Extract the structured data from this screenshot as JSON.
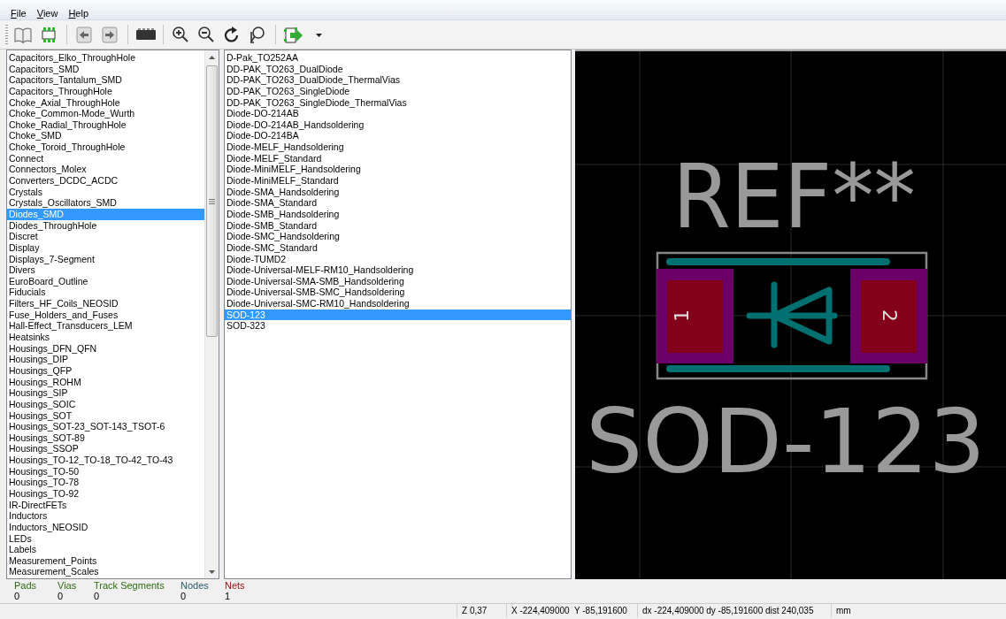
{
  "menu": [
    {
      "label": "File"
    },
    {
      "label": "View"
    },
    {
      "label": "Help"
    }
  ],
  "libraries": [
    {
      "name": "Capacitors_Elko_ThroughHole",
      "selected": false
    },
    {
      "name": "Capacitors_SMD",
      "selected": false
    },
    {
      "name": "Capacitors_Tantalum_SMD",
      "selected": false
    },
    {
      "name": "Capacitors_ThroughHole",
      "selected": false
    },
    {
      "name": "Choke_Axial_ThroughHole",
      "selected": false
    },
    {
      "name": "Choke_Common-Mode_Wurth",
      "selected": false
    },
    {
      "name": "Choke_Radial_ThroughHole",
      "selected": false
    },
    {
      "name": "Choke_SMD",
      "selected": false
    },
    {
      "name": "Choke_Toroid_ThroughHole",
      "selected": false
    },
    {
      "name": "Connect",
      "selected": false
    },
    {
      "name": "Connectors_Molex",
      "selected": false
    },
    {
      "name": "Converters_DCDC_ACDC",
      "selected": false
    },
    {
      "name": "Crystals",
      "selected": false
    },
    {
      "name": "Crystals_Oscillators_SMD",
      "selected": false
    },
    {
      "name": "Diodes_SMD",
      "selected": true
    },
    {
      "name": "Diodes_ThroughHole",
      "selected": false
    },
    {
      "name": "Discret",
      "selected": false
    },
    {
      "name": "Display",
      "selected": false
    },
    {
      "name": "Displays_7-Segment",
      "selected": false
    },
    {
      "name": "Divers",
      "selected": false
    },
    {
      "name": "EuroBoard_Outline",
      "selected": false
    },
    {
      "name": "Fiducials",
      "selected": false
    },
    {
      "name": "Filters_HF_Coils_NEOSID",
      "selected": false
    },
    {
      "name": "Fuse_Holders_and_Fuses",
      "selected": false
    },
    {
      "name": "Hall-Effect_Transducers_LEM",
      "selected": false
    },
    {
      "name": "Heatsinks",
      "selected": false
    },
    {
      "name": "Housings_DFN_QFN",
      "selected": false
    },
    {
      "name": "Housings_DIP",
      "selected": false
    },
    {
      "name": "Housings_QFP",
      "selected": false
    },
    {
      "name": "Housings_ROHM",
      "selected": false
    },
    {
      "name": "Housings_SIP",
      "selected": false
    },
    {
      "name": "Housings_SOIC",
      "selected": false
    },
    {
      "name": "Housings_SOT",
      "selected": false
    },
    {
      "name": "Housings_SOT-23_SOT-143_TSOT-6",
      "selected": false
    },
    {
      "name": "Housings_SOT-89",
      "selected": false
    },
    {
      "name": "Housings_SSOP",
      "selected": false
    },
    {
      "name": "Housings_TO-12_TO-18_TO-42_TO-43",
      "selected": false
    },
    {
      "name": "Housings_TO-50",
      "selected": false
    },
    {
      "name": "Housings_TO-78",
      "selected": false
    },
    {
      "name": "Housings_TO-92",
      "selected": false
    },
    {
      "name": "IR-DirectFETs",
      "selected": false
    },
    {
      "name": "Inductors",
      "selected": false
    },
    {
      "name": "Inductors_NEOSID",
      "selected": false
    },
    {
      "name": "LEDs",
      "selected": false
    },
    {
      "name": "Labels",
      "selected": false
    },
    {
      "name": "Measurement_Points",
      "selected": false
    },
    {
      "name": "Measurement_Scales",
      "selected": false
    }
  ],
  "footprints": [
    {
      "name": "D-Pak_TO252AA",
      "selected": false
    },
    {
      "name": "DD-PAK_TO263_DualDiode",
      "selected": false
    },
    {
      "name": "DD-PAK_TO263_DualDiode_ThermalVias",
      "selected": false
    },
    {
      "name": "DD-PAK_TO263_SingleDiode",
      "selected": false
    },
    {
      "name": "DD-PAK_TO263_SingleDiode_ThermalVias",
      "selected": false
    },
    {
      "name": "Diode-DO-214AB",
      "selected": false
    },
    {
      "name": "Diode-DO-214AB_Handsoldering",
      "selected": false
    },
    {
      "name": "Diode-DO-214BA",
      "selected": false
    },
    {
      "name": "Diode-MELF_Handsoldering",
      "selected": false
    },
    {
      "name": "Diode-MELF_Standard",
      "selected": false
    },
    {
      "name": "Diode-MiniMELF_Handsoldering",
      "selected": false
    },
    {
      "name": "Diode-MiniMELF_Standard",
      "selected": false
    },
    {
      "name": "Diode-SMA_Handsoldering",
      "selected": false
    },
    {
      "name": "Diode-SMA_Standard",
      "selected": false
    },
    {
      "name": "Diode-SMB_Handsoldering",
      "selected": false
    },
    {
      "name": "Diode-SMB_Standard",
      "selected": false
    },
    {
      "name": "Diode-SMC_Handsoldering",
      "selected": false
    },
    {
      "name": "Diode-SMC_Standard",
      "selected": false
    },
    {
      "name": "Diode-TUMD2",
      "selected": false
    },
    {
      "name": "Diode-Universal-MELF-RM10_Handsoldering",
      "selected": false
    },
    {
      "name": "Diode-Universal-SMA-SMB_Handsoldering",
      "selected": false
    },
    {
      "name": "Diode-Universal-SMB-SMC_Handsoldering",
      "selected": false
    },
    {
      "name": "Diode-Universal-SMC-RM10_Handsoldering",
      "selected": false
    },
    {
      "name": "SOD-123",
      "selected": true
    },
    {
      "name": "SOD-323",
      "selected": false
    }
  ],
  "footprint": {
    "reference": "REF**",
    "value": "SOD-123",
    "pads": [
      "1",
      "2"
    ]
  },
  "messages": [
    {
      "label": "Pads",
      "value": "0",
      "color": "#2e6b12"
    },
    {
      "label": "Vias",
      "value": "0",
      "color": "#2e6b12"
    },
    {
      "label": "Track Segments",
      "value": "0",
      "color": "#2e6b12"
    },
    {
      "label": "Nodes",
      "value": "0",
      "color": "#2a5a6a"
    },
    {
      "label": "Nets",
      "value": "1",
      "color": "#a01010"
    }
  ],
  "status_bar": [
    "Z 0,37",
    "X -224,409000  Y -85,191600",
    "dx -224,409000 dy -85,191600 dist 240,035",
    "mm"
  ]
}
